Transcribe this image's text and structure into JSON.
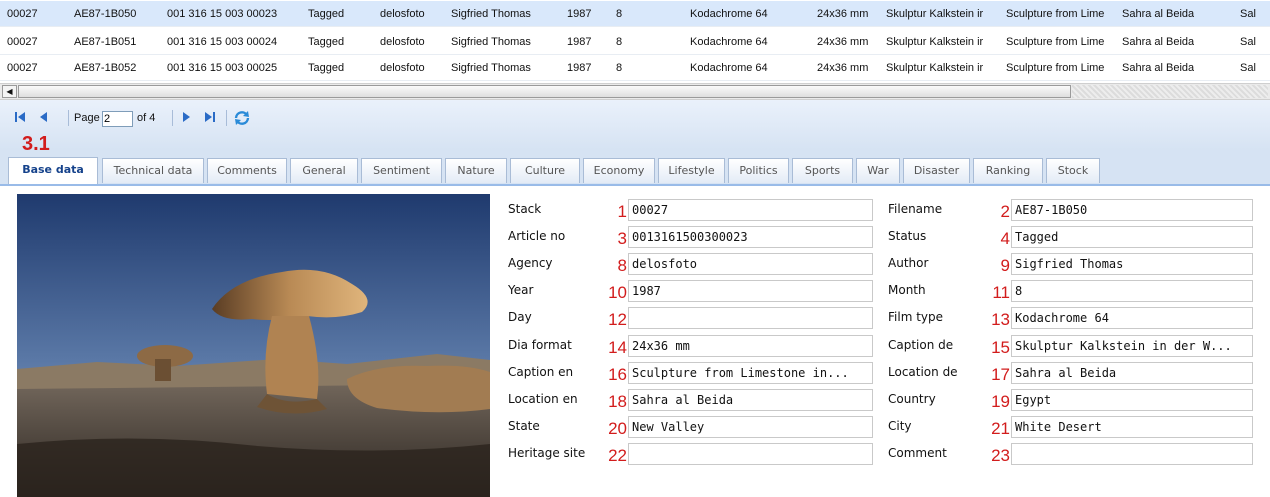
{
  "grid": {
    "rows": [
      {
        "stack": "00027",
        "filename": "AE87-1B050",
        "article": "001 316 15 003 00023",
        "status": "Tagged",
        "agency": "delosfoto",
        "author": "Sigfried Thomas",
        "year": "1987",
        "month": "8",
        "film": "Kodachrome 64",
        "dia": "24x36 mm",
        "caption_de": "Skulptur Kalkstein ir",
        "caption_en": "Sculpture from Lime",
        "location": "Sahra al Beida",
        "extra": "Sal"
      },
      {
        "stack": "00027",
        "filename": "AE87-1B051",
        "article": "001 316 15 003 00024",
        "status": "Tagged",
        "agency": "delosfoto",
        "author": "Sigfried Thomas",
        "year": "1987",
        "month": "8",
        "film": "Kodachrome 64",
        "dia": "24x36 mm",
        "caption_de": "Skulptur Kalkstein ir",
        "caption_en": "Sculpture from Lime",
        "location": "Sahra al Beida",
        "extra": "Sal"
      },
      {
        "stack": "00027",
        "filename": "AE87-1B052",
        "article": "001 316 15 003 00025",
        "status": "Tagged",
        "agency": "delosfoto",
        "author": "Sigfried Thomas",
        "year": "1987",
        "month": "8",
        "film": "Kodachrome 64",
        "dia": "24x36 mm",
        "caption_de": "Skulptur Kalkstein ir",
        "caption_en": "Sculpture from Lime",
        "location": "Sahra al Beida",
        "extra": "Sal"
      }
    ]
  },
  "pager": {
    "page_label": "Page",
    "page_value": "2",
    "of_label": "of 4"
  },
  "annotation_label": "3.1",
  "tabs": [
    {
      "label": "Base data",
      "active": true
    },
    {
      "label": "Technical data"
    },
    {
      "label": "Comments"
    },
    {
      "label": "General"
    },
    {
      "label": "Sentiment"
    },
    {
      "label": "Nature"
    },
    {
      "label": "Culture"
    },
    {
      "label": "Economy"
    },
    {
      "label": "Lifestyle"
    },
    {
      "label": "Politics"
    },
    {
      "label": "Sports"
    },
    {
      "label": "War"
    },
    {
      "label": "Disaster"
    },
    {
      "label": "Ranking"
    },
    {
      "label": "Stock"
    }
  ],
  "form": {
    "left": [
      {
        "label": "Stack",
        "num": "1",
        "value": "00027"
      },
      {
        "label": "Article no",
        "num": "3",
        "value": "0013161500300023"
      },
      {
        "label": "Agency",
        "num": "8",
        "value": "delosfoto"
      },
      {
        "label": "Year",
        "num": "10",
        "value": "1987"
      },
      {
        "label": "Day",
        "num": "12",
        "value": ""
      },
      {
        "label": "Dia format",
        "num": "14",
        "value": "24x36 mm"
      },
      {
        "label": "Caption en",
        "num": "16",
        "value": "Sculpture from Limestone in..."
      },
      {
        "label": "Location en",
        "num": "18",
        "value": "Sahra al Beida"
      },
      {
        "label": "State",
        "num": "20",
        "value": "New Valley"
      },
      {
        "label": "Heritage site",
        "num": "22",
        "value": ""
      }
    ],
    "right": [
      {
        "label": "Filename",
        "num": "2",
        "value": "AE87-1B050"
      },
      {
        "label": "Status",
        "num": "4",
        "value": "Tagged"
      },
      {
        "label": "Author",
        "num": "9",
        "value": "Sigfried Thomas"
      },
      {
        "label": "Month",
        "num": "11",
        "value": "8"
      },
      {
        "label": "Film type",
        "num": "13",
        "value": "Kodachrome 64"
      },
      {
        "label": "Caption de",
        "num": "15",
        "value": "Skulptur Kalkstein in der W..."
      },
      {
        "label": "Location de",
        "num": "17",
        "value": "Sahra al Beida"
      },
      {
        "label": "Country",
        "num": "19",
        "value": "Egypt"
      },
      {
        "label": "City",
        "num": "21",
        "value": "White Desert"
      },
      {
        "label": "Comment",
        "num": "23",
        "value": ""
      }
    ]
  },
  "colors": {
    "selected_row": "#d9e8fb",
    "annotation": "#d21c1c",
    "toolbar": "#d6e3f3",
    "active_tab_text": "#15428b"
  },
  "icons": {
    "first": "first-page-icon",
    "prev": "prev-page-icon",
    "next": "next-page-icon",
    "last": "last-page-icon",
    "refresh": "refresh-icon"
  }
}
